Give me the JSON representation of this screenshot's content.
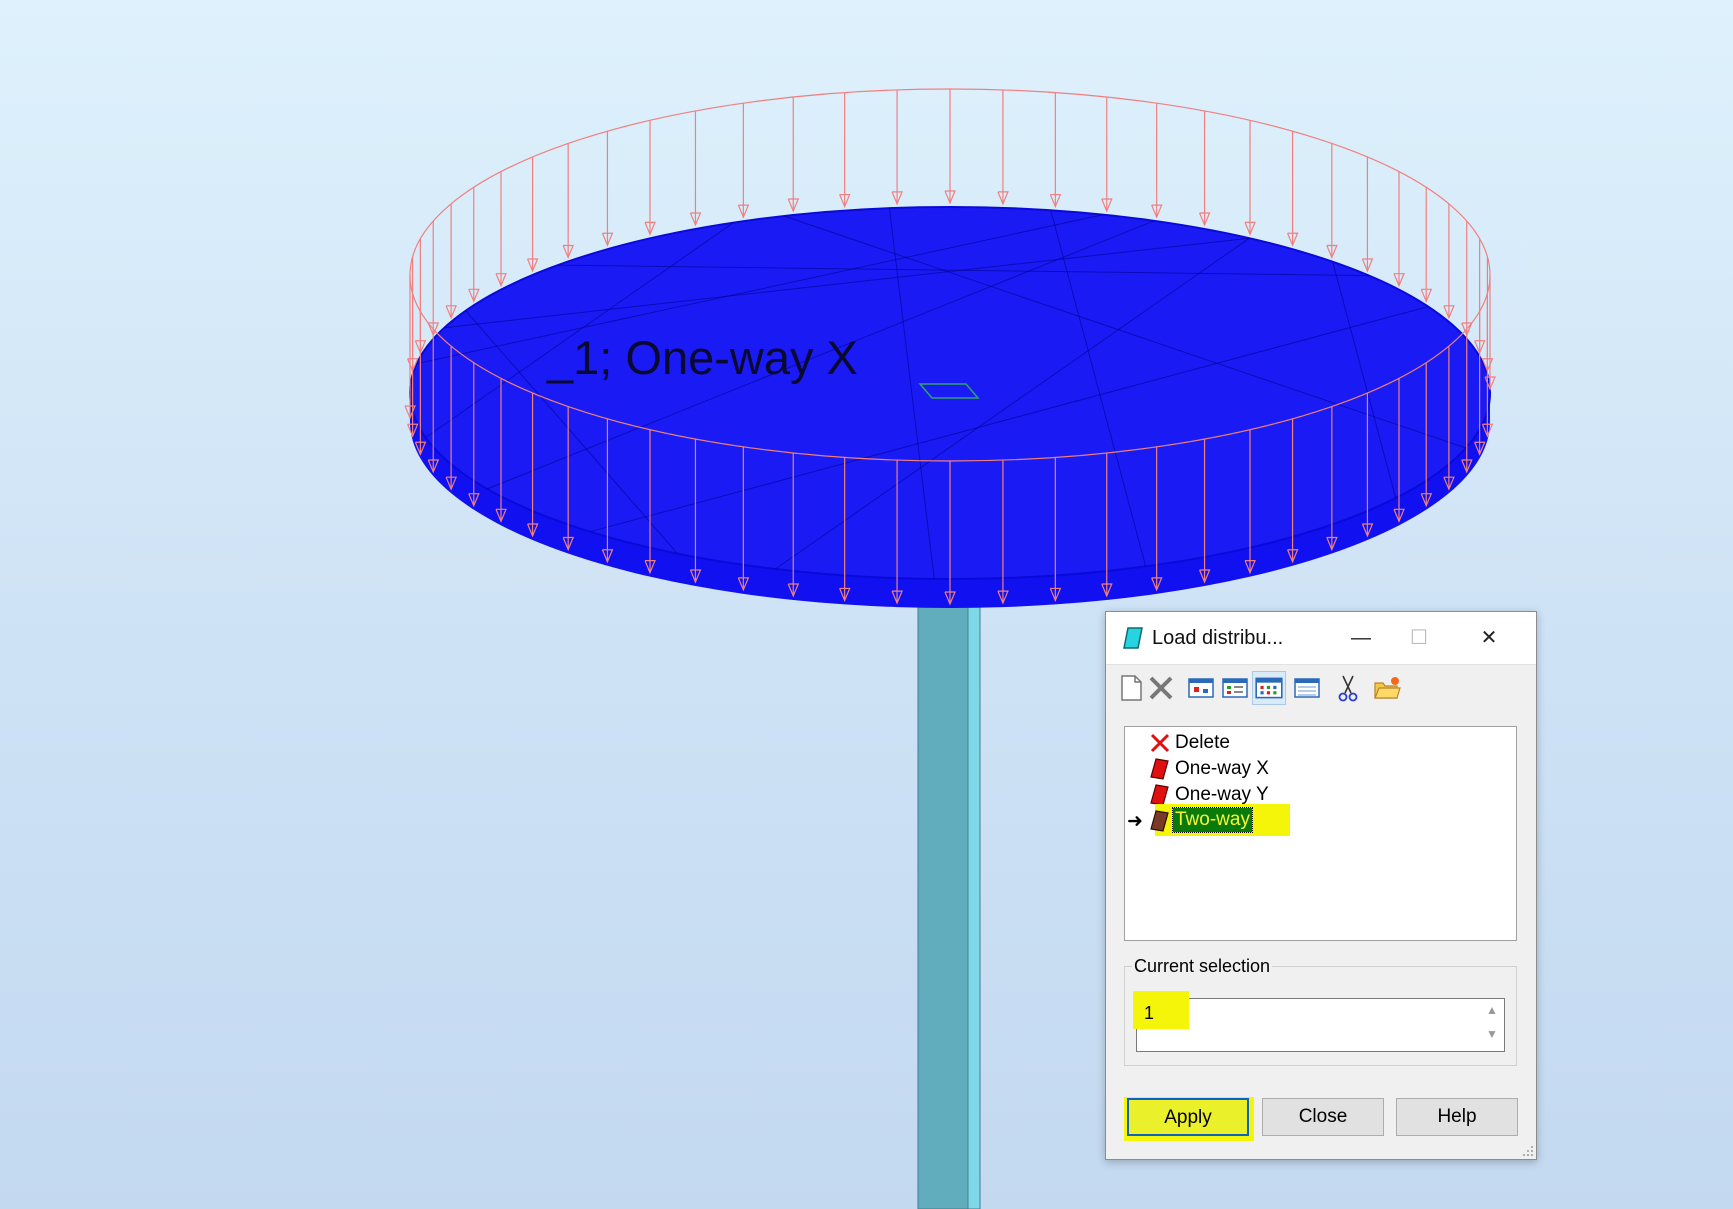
{
  "viewport": {
    "slab_label": "_1; One-way X"
  },
  "dialog": {
    "title": "Load distribu...",
    "window_controls": {
      "minimize": "—",
      "maximize": "☐",
      "close": "✕"
    },
    "toolbar": {
      "icons": [
        "new-icon",
        "delete-icon",
        "view-list-icon",
        "view-small-icon",
        "view-grid-icon",
        "view-detail-icon",
        "scissors-icon",
        "open-folder-icon"
      ]
    },
    "list": {
      "items": [
        {
          "label": "Delete",
          "icon": "red-x-icon"
        },
        {
          "label": "One-way X",
          "icon": "red-slab-icon"
        },
        {
          "label": "One-way Y",
          "icon": "red-slab-icon"
        },
        {
          "label": "Two-way",
          "icon": "brown-slab-icon",
          "selected": true,
          "marker": "➜"
        }
      ]
    },
    "current_selection": {
      "title": "Current selection",
      "value": "1"
    },
    "buttons": {
      "apply": "Apply",
      "close": "Close",
      "help": "Help"
    }
  },
  "colors": {
    "slab": "#1010f0",
    "load_arrows": "#f08080",
    "column": "#62adbd",
    "highlight": "#f5f50a",
    "selected_bg": "#0a7a0a"
  }
}
